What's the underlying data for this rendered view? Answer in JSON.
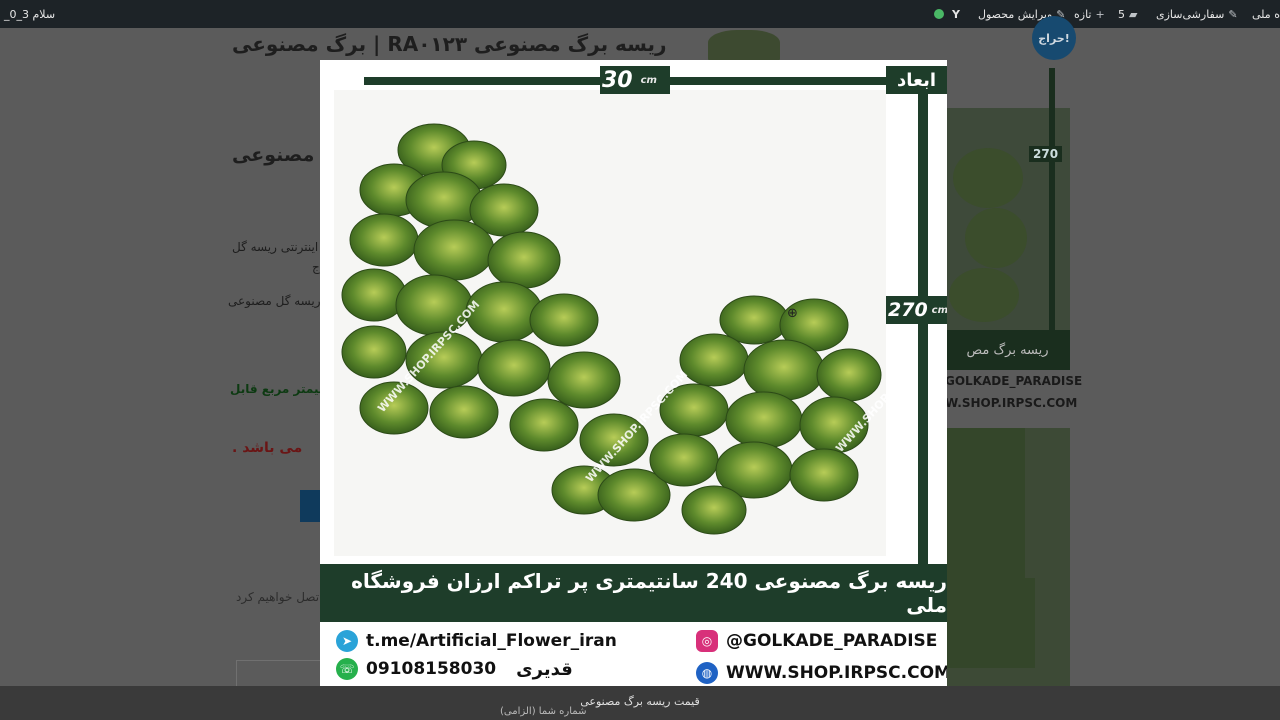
{
  "admin_bar": {
    "greeting": "سلام 3_0_",
    "site_name": "ه ملی",
    "customize": "سفارشی‌سازی",
    "comments_count": "5",
    "new_label": "تازه",
    "edit_product": "ویرایش محصول",
    "yoast_label": "Y"
  },
  "page": {
    "title": "ریسه برگ مصنوعی RA۰۱۲۳ | برگ مصنوعی",
    "subtitle": "ت مصنوعی",
    "desc1": "اینترنتی ریسه گل",
    "desc2": "ج",
    "desc3": "ریسه گل مصنوعی",
    "green_line": "سانتیمتر مربع قابل",
    "red_line": "می باشد .",
    "gray_line": "تصل خواهیم کرد",
    "sale_badge": "حراج!",
    "thumb_270": "270",
    "thumb_bar": "ریسه برگ مص",
    "handle_ig": "GOLKADE_PARADISE",
    "handle_web": "W.SHOP.IRPSC.COM",
    "bottom_caption": "قیمت ریسه برگ مصنوعی",
    "phone_field_label": "شماره شما (الزامی)"
  },
  "lightbox": {
    "dim_width": "30",
    "dim_width_unit": "cm",
    "dim_label": "ابعاد",
    "dim_height": "270",
    "dim_height_unit": "cm",
    "watermark": "WWW.SHOP.IRPSC.COM",
    "banner": "ریسه برگ مصنوعی 240 سانتیمتری پر تراکم ارزان فروشگاه ملی",
    "telegram": "t.me/Artificial_Flower_iran",
    "whatsapp_number": "09108158030",
    "whatsapp_name": "قدیری",
    "instagram": "@GOLKADE_PARADISE",
    "website": "WWW.SHOP.IRPSC.COM",
    "accent_color": "#1e3d2a"
  }
}
